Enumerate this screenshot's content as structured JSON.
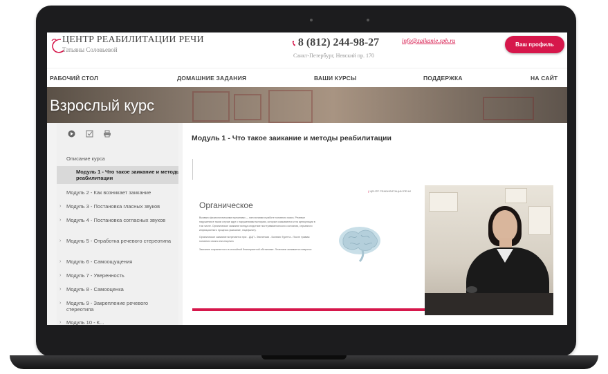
{
  "site": {
    "logo_title": "ЦЕНТР РЕАБИЛИТАЦИИ РЕЧИ",
    "logo_subtitle": "Татьяны Соловьевой",
    "phone": "8 (812) 244-98-27",
    "address": "Санкт-Петербург, Невский пр. 170",
    "email": "info@zaikanie.spb.ru",
    "profile_button": "Ваш профиль",
    "brand_color": "#d6174b"
  },
  "nav": {
    "items": [
      {
        "label": "РАБОЧИЙ СТОЛ"
      },
      {
        "label": "ДОМАШНИЕ ЗАДАНИЯ"
      },
      {
        "label": "ВАШИ КУРСЫ"
      },
      {
        "label": "ПОДДЕРЖКА"
      },
      {
        "label": "НА САЙТ"
      }
    ]
  },
  "banner": {
    "title": "Взрослый курс"
  },
  "sidebar": {
    "icons": [
      "play-icon",
      "checklist-icon",
      "print-icon"
    ],
    "items": [
      {
        "label": "Описание курса",
        "arrow": "",
        "active": false
      },
      {
        "label": "Модуль 1 - Что такое заикание и методы реабилитации",
        "arrow": "",
        "active": true
      },
      {
        "label": "Модуль 2 - Как возникает заикание",
        "arrow": "",
        "active": false
      },
      {
        "label": "Модуль 3 - Постановка гласных звуков",
        "arrow": "›",
        "active": false
      },
      {
        "label": "Модуль 4 - Постановка согласных звуков",
        "arrow": "›",
        "active": false
      },
      {
        "label": "Модуль 5 - Отработка речевого стереотипа",
        "arrow": "›",
        "active": false
      },
      {
        "label": "Модуль 6 - Самоощущения",
        "arrow": "›",
        "active": false
      },
      {
        "label": "Модуль 7 - Уверенность",
        "arrow": "›",
        "active": false
      },
      {
        "label": "Модуль 8 - Самооценка",
        "arrow": "›",
        "active": false
      },
      {
        "label": "Модуль 9 - Закрепление речевого стереотипа",
        "arrow": "›",
        "active": false
      },
      {
        "label": "Модуль 10 - К...",
        "arrow": "›",
        "active": false
      }
    ]
  },
  "main": {
    "module_title": "Модуль 1 - Что такое заикание и методы реабилитации"
  },
  "video": {
    "slide_logo": "ЦЕНТР РЕАБИЛИТАЦИИ РЕЧИ",
    "slide_title": "Органическое",
    "slide_paragraph_1": "Вызвано физиологическими причинами — патологиями в работе головного мозга. Речевые нарушения в таком случае идут с нарушениями моторики, которые сказываются и на артикуляции в том числе. Органическое заикание всегда следствие посттравматического состояния, серьезного инфекционного процесса (заикание, энцефалит).",
    "slide_paragraph_2": "Органическое заикание встречается при: - ДЦП - Эпилепсии - Болезни Туретта - После травмы головного мозга или инсульта",
    "slide_paragraph_3": "Заикание сохраняется и в спокойной благоприятной обстановке. Лечением занимается невролог."
  }
}
